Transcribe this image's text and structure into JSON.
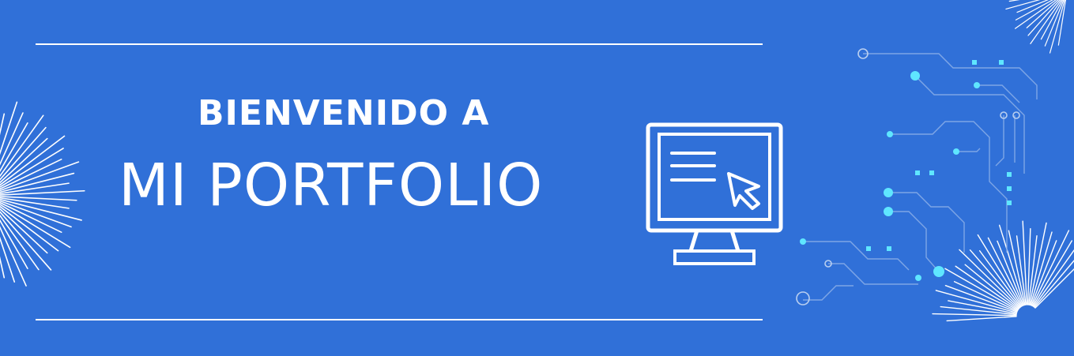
{
  "banner": {
    "heading_small": "BIENVENIDO A",
    "heading_large": "MI PORTFOLIO",
    "background_color": "#3070d8",
    "accent_color": "#5fe6ff",
    "icons": [
      "monitor-icon",
      "document-lines-icon",
      "cursor-arrow-icon",
      "starburst-decoration",
      "circuit-board-decoration"
    ]
  }
}
